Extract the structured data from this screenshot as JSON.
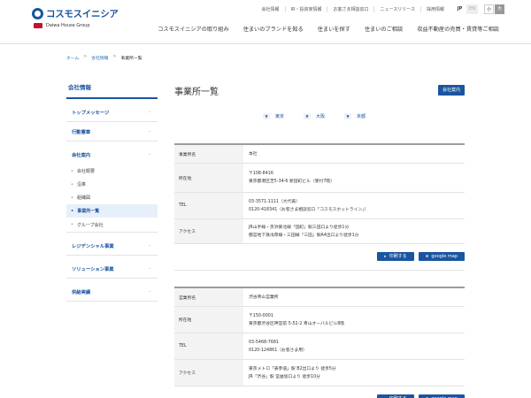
{
  "header": {
    "logo_text": "コスモスイニシア",
    "logo_sub": "Daiwa House Group",
    "util_links": [
      "会社情報",
      "IR・投資家情報",
      "お客さま相談窓口",
      "ニュースリリース",
      "採用情報"
    ],
    "lang": {
      "jp": "JP",
      "en": "EN"
    },
    "font_size": {
      "small": "小",
      "large": "大"
    },
    "gnav": [
      "コスモスイニシアの取り組み",
      "住まいのブランドを知る",
      "住まいを探す",
      "住まいのご相談",
      "収益不動産の売買・賃貸等ご相談"
    ]
  },
  "breadcrumb": [
    "ホーム",
    "会社情報",
    "事業所一覧"
  ],
  "sidebar": {
    "title": "会社情報",
    "sections": {
      "top_message": "トップメッセージ",
      "action_guideline": "行動憲章",
      "company_guide": "会社案内",
      "residential": "レジデンシャル事業",
      "solution": "ソリューション事業",
      "supply": "供給実績"
    },
    "sub_items": [
      "会社概要",
      "沿革",
      "組織図",
      "事業所一覧",
      "グループ会社"
    ],
    "dash": "-"
  },
  "main": {
    "title": "事業所一覧",
    "guide_button": "会社案内",
    "anchors": [
      {
        "mark": "▼",
        "label": "東京"
      },
      {
        "mark": "▼",
        "label": "大阪"
      },
      {
        "mark": "▼",
        "label": "京都"
      }
    ],
    "offices": [
      {
        "rows": [
          {
            "label": "事業所名",
            "lines": [
              "本社"
            ]
          },
          {
            "label": "所在地",
            "lines": [
              "〒108-8416",
              "東京都港区芝5-34-6 新田町ビル（受付7階）"
            ]
          },
          {
            "label": "TEL",
            "lines": [
              "03-3571-1111（大代表）",
              "0120-418341（お客さま相談窓口「コスモスホットライン」）"
            ]
          },
          {
            "label": "アクセス",
            "lines": [
              "JR山手線・京浜東北線「田町」駅三田口より徒歩1分",
              "都営地下鉄浅草線・三田線「三田」駅A4出口より徒歩1分"
            ]
          }
        ]
      },
      {
        "rows": [
          {
            "label": "営業所名",
            "lines": [
              "渋谷青山営業所"
            ]
          },
          {
            "label": "所在地",
            "lines": [
              "〒150-0001",
              "東京都渋谷区神宮前 5-52-2 青山オーバルビル8階"
            ]
          },
          {
            "label": "TEL",
            "lines": [
              "03-5468-7681",
              "0120-124861（お客さま用）"
            ]
          },
          {
            "label": "アクセス",
            "lines": [
              "東京メトロ「表参道」駅 B2出口より 徒歩5分",
              "JR「渋谷」駅 宮益坂口より 徒歩10分"
            ]
          }
        ]
      }
    ],
    "buttons": {
      "print": "印刷する",
      "map": "google map"
    },
    "icons": {
      "print": "▸",
      "map": "⊕"
    }
  },
  "colors": {
    "brand": "#1a55a0",
    "accent_red": "#c8102e"
  }
}
